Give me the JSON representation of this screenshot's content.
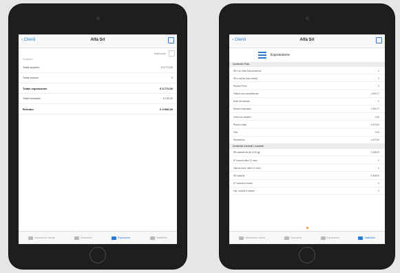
{
  "left": {
    "nav": {
      "back": "Clienti",
      "title": "Alfa Srl"
    },
    "column_header": "Saldi mese",
    "rows": [
      {
        "label": "Scoperto",
        "value": "",
        "kind": "sec"
      },
      {
        "label": "Totale scoperto",
        "value": "€ 3.772,00",
        "kind": "normal"
      },
      {
        "label": "Totale insoluto",
        "value": "0",
        "kind": "normal"
      },
      {
        "label": "Totale esposizione",
        "value": "€ 3.772,00",
        "kind": "bold"
      },
      {
        "label": "Totale incassato",
        "value": "€ 232,00",
        "kind": "normal"
      },
      {
        "label": "Residuo",
        "value": "€ 3.540,00",
        "kind": "bold"
      }
    ],
    "tabs": [
      {
        "label": "Informazioni cliente",
        "active": false
      },
      {
        "label": "Documenti",
        "active": false
      },
      {
        "label": "Esposizione",
        "active": true
      },
      {
        "label": "Statistiche",
        "active": false
      }
    ]
  },
  "right": {
    "nav": {
      "back": "Clienti",
      "title": "Alfa Srl"
    },
    "section_title": "Esposizione",
    "groups": [
      {
        "title": "Controllo Fido",
        "rows": [
          {
            "label": "RB Con Date Autorizzazione",
            "value": "0"
          },
          {
            "label": "RB a rischio (solo clienti)",
            "value": "0"
          },
          {
            "label": "Rischio Primo",
            "value": "0"
          },
          {
            "label": "Fatture non contabilizzate",
            "value": "1.950,77"
          },
          {
            "label": "Bolle da fatturare",
            "value": "0"
          },
          {
            "label": "Rischio finanziario",
            "value": "1.950,77"
          },
          {
            "label": "Ordini da evadere",
            "value": "0,00"
          },
          {
            "label": "Rischio totale",
            "value": "1.970,00"
          },
          {
            "label": "Fido",
            "value": "0,00"
          },
          {
            "label": "Sforamento",
            "value": "1.970,00"
          }
        ]
      },
      {
        "title": "Controllo insoluti / scaduto",
        "rows": [
          {
            "label": "RB scadute da più di 30 gg",
            "value": "2.308,00"
          },
          {
            "label": "N° insoluti ultimi 12 mesi",
            "value": "0"
          },
          {
            "label": "Importo insol. ultimi 12 mesi",
            "value": "0"
          },
          {
            "label": "RB scadute",
            "value": "2.308,00"
          },
          {
            "label": "N° insoluti in essere",
            "value": "0"
          },
          {
            "label": "Imp. insoluti in essere",
            "value": "0"
          }
        ]
      }
    ],
    "tabs": [
      {
        "label": "Informazioni cliente",
        "active": false
      },
      {
        "label": "Documenti",
        "active": false
      },
      {
        "label": "Esposizione",
        "active": false
      },
      {
        "label": "Statistiche",
        "active": true
      }
    ]
  }
}
